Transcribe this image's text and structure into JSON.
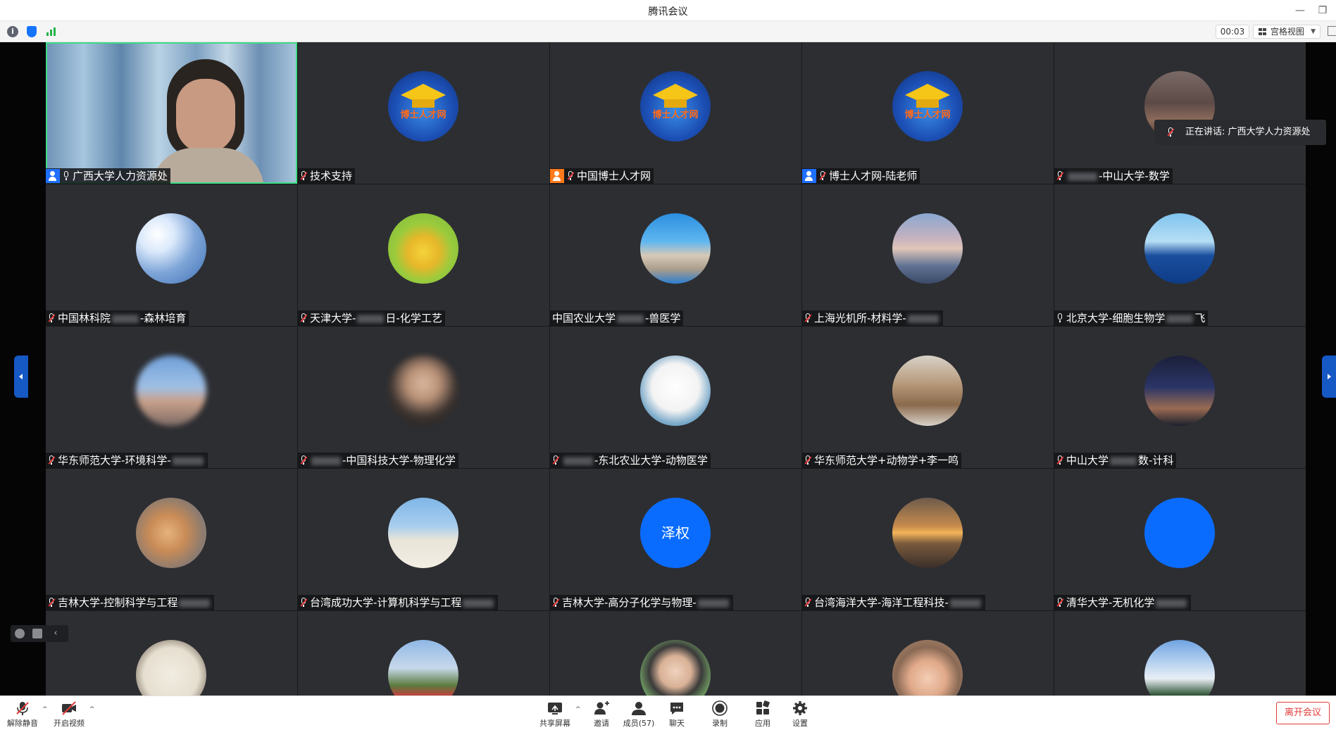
{
  "window": {
    "title": "腾讯会议",
    "minimize_icon": "minimize-icon",
    "restore_icon": "restore-icon"
  },
  "infobar": {
    "info_icon": "info-icon",
    "info_glyph": "i",
    "security_icon": "shield-icon",
    "network_icon": "signal-icon",
    "timer": "00:03",
    "view_label": "宫格视图",
    "view_caret": "▼"
  },
  "speaking_notice": "正在讲话: 广西大学人力资源处",
  "colors": {
    "accent": "#1e6fff",
    "cohost": "#ff7a1a",
    "leave": "#e33b3b",
    "active_border": "#3ddc84",
    "tile_bg": "#2d2e32",
    "avatar_blue": "#0a6cff"
  },
  "tiles": [
    {
      "row": 0,
      "col": 0,
      "type": "video",
      "name": "广西大学人力资源处",
      "role": "host",
      "mic": "on",
      "hidden_text": false
    },
    {
      "row": 0,
      "col": 1,
      "type": "avatar",
      "avatar": "doctor-talent-logo",
      "name": "技术支持",
      "role": "",
      "mic": "muted"
    },
    {
      "row": 0,
      "col": 2,
      "type": "avatar",
      "avatar": "doctor-talent-logo",
      "name": "中国博士人才网",
      "role": "cohost",
      "mic": "muted"
    },
    {
      "row": 0,
      "col": 3,
      "type": "avatar",
      "avatar": "doctor-talent-logo",
      "name": "博士人才网-陆老师",
      "role": "host",
      "mic": "muted"
    },
    {
      "row": 0,
      "col": 4,
      "type": "avatar",
      "avatar": "sunset-couple-photo",
      "name": "-中山大学-数学",
      "role": "",
      "mic": "muted",
      "blur_before": true
    },
    {
      "row": 1,
      "col": 0,
      "type": "avatar",
      "avatar": "cloud-sky-photo",
      "name": "中国林科院",
      "name2": "-森林培育",
      "role": "",
      "mic": "muted",
      "blur_middle": true
    },
    {
      "row": 1,
      "col": 1,
      "type": "avatar",
      "avatar": "cartoon-bee",
      "name": "天津大学-",
      "name2": "日-化学工艺",
      "role": "",
      "mic": "muted",
      "blur_middle": true
    },
    {
      "row": 1,
      "col": 2,
      "type": "avatar",
      "avatar": "balance-stone-photo",
      "name": "中国农业大学",
      "name2": "-兽医学",
      "role": "",
      "mic": "none",
      "blur_middle": true
    },
    {
      "row": 1,
      "col": 3,
      "type": "avatar",
      "avatar": "lake-dusk-photo",
      "name": "上海光机所-材料学-",
      "role": "",
      "mic": "muted",
      "blur_after": true
    },
    {
      "row": 1,
      "col": 4,
      "type": "avatar",
      "avatar": "ocean-bike-photo",
      "name": "北京大学-细胞生物学",
      "name2": "飞",
      "role": "",
      "mic": "on",
      "blur_middle": true
    },
    {
      "row": 2,
      "col": 0,
      "type": "avatar",
      "avatar": "blurred-sky",
      "name": "华东师范大学-环境科学-",
      "role": "",
      "mic": "muted",
      "blur_after": true,
      "blur_avatar": true
    },
    {
      "row": 2,
      "col": 1,
      "type": "avatar",
      "avatar": "blurred-portrait",
      "name": "-中国科技大学-物理化学",
      "role": "",
      "mic": "muted",
      "blur_before": true,
      "blur_avatar": true
    },
    {
      "row": 2,
      "col": 2,
      "type": "avatar",
      "avatar": "sketch-man",
      "name": "-东北农业大学-动物医学",
      "role": "",
      "mic": "muted",
      "blur_before": true
    },
    {
      "row": 2,
      "col": 3,
      "type": "avatar",
      "avatar": "teddy-bear-photo",
      "name": "华东师范大学+动物学+李一鸣",
      "role": "",
      "mic": "muted"
    },
    {
      "row": 2,
      "col": 4,
      "type": "avatar",
      "avatar": "night-sky-photo",
      "name": "中山大学",
      "name2": "数-计科",
      "role": "",
      "mic": "muted",
      "blur_middle": true
    },
    {
      "row": 3,
      "col": 0,
      "type": "avatar",
      "avatar": "cats-photo",
      "name": "吉林大学-控制科学与工程",
      "role": "",
      "mic": "muted",
      "blur_after": true
    },
    {
      "row": 3,
      "col": 1,
      "type": "avatar",
      "avatar": "beach-photo",
      "name": "台湾成功大学-计算机科学与工程",
      "role": "",
      "mic": "muted",
      "blur_after": true
    },
    {
      "row": 3,
      "col": 2,
      "type": "avatar",
      "avatar": "text-avatar",
      "avatar_text": "泽权",
      "name": "吉林大学-高分子化学与物理-",
      "role": "",
      "mic": "muted",
      "blur_after": true
    },
    {
      "row": 3,
      "col": 3,
      "type": "avatar",
      "avatar": "sunset-sea-photo",
      "name": "台湾海洋大学-海洋工程科技-",
      "role": "",
      "mic": "muted",
      "blur_after": true
    },
    {
      "row": 3,
      "col": 4,
      "type": "avatar",
      "avatar": "text-avatar-blurred",
      "avatar_text": "",
      "name": "清华大学-无机化学",
      "role": "",
      "mic": "muted",
      "blur_after": true
    },
    {
      "row": 4,
      "col": 0,
      "type": "avatar",
      "avatar": "cartoon-cat",
      "name": "",
      "role": "",
      "mic": "none"
    },
    {
      "row": 4,
      "col": 1,
      "type": "avatar",
      "avatar": "group-photo",
      "name": "",
      "role": "",
      "mic": "none"
    },
    {
      "row": 4,
      "col": 2,
      "type": "avatar",
      "avatar": "man-portrait",
      "name": "",
      "role": "",
      "mic": "none"
    },
    {
      "row": 4,
      "col": 3,
      "type": "avatar",
      "avatar": "baby-photo",
      "name": "",
      "role": "",
      "mic": "none"
    },
    {
      "row": 4,
      "col": 4,
      "type": "avatar",
      "avatar": "mountain-photo",
      "name": "",
      "role": "",
      "mic": "none"
    }
  ],
  "minitools": {
    "emoji_icon": "emoji-icon",
    "chat_icon": "chat-bubble-icon",
    "collapse_icon": "chevron-left-icon",
    "collapse_glyph": "‹"
  },
  "toolbar": {
    "unmute_label": "解除静音",
    "video_label": "开启视频",
    "share_label": "共享屏幕",
    "invite_label": "邀请",
    "members_label": "成员(57)",
    "chat_label": "聊天",
    "record_label": "录制",
    "apps_label": "应用",
    "settings_label": "设置",
    "leave_label": "离开会议",
    "caret_glyph": "^"
  }
}
